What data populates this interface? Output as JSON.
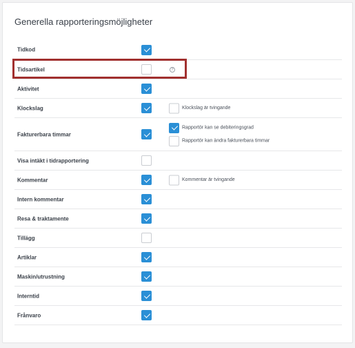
{
  "section_title": "Generella rapporteringsmöjligheter",
  "colors": {
    "checkbox_checked": "#2a8fd6",
    "highlight_border": "#a1302f"
  },
  "rows": [
    {
      "label": "Tidkod",
      "checked": true
    },
    {
      "label": "Tidsartikel",
      "checked": false,
      "help_icon": "question-circle-icon",
      "highlighted": true
    },
    {
      "label": "Aktivitet",
      "checked": true
    },
    {
      "label": "Klockslag",
      "checked": true,
      "options": [
        {
          "label": "Klockslag är tvingande",
          "checked": false
        }
      ]
    },
    {
      "label": "Fakturerbara timmar",
      "checked": true,
      "options": [
        {
          "label": "Rapportör kan se debiteringsgrad",
          "checked": true
        },
        {
          "label": "Rapportör kan ändra fakturerbara timmar",
          "checked": false
        }
      ]
    },
    {
      "label": "Visa intäkt i tidrapportering",
      "checked": false
    },
    {
      "label": "Kommentar",
      "checked": true,
      "options": [
        {
          "label": "Kommentar är tvingande",
          "checked": false
        }
      ]
    },
    {
      "label": "Intern kommentar",
      "checked": true
    },
    {
      "label": "Resa & traktamente",
      "checked": true
    },
    {
      "label": "Tillägg",
      "checked": false
    },
    {
      "label": "Artiklar",
      "checked": true
    },
    {
      "label": "Maskin/utrustning",
      "checked": true
    },
    {
      "label": "Interntid",
      "checked": true
    },
    {
      "label": "Frånvaro",
      "checked": true
    }
  ]
}
